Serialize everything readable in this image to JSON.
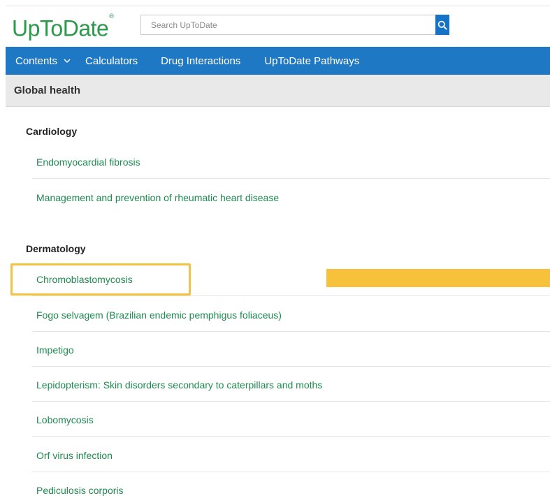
{
  "header": {
    "logo_text": "UpToDate",
    "logo_mark": "®",
    "search_placeholder": "Search UpToDate",
    "search_icon": "search-icon"
  },
  "nav": {
    "items": [
      {
        "label": "Contents",
        "has_dropdown": true
      },
      {
        "label": "Calculators"
      },
      {
        "label": "Drug Interactions"
      },
      {
        "label": "UpToDate Pathways"
      }
    ]
  },
  "page": {
    "title": "Global health"
  },
  "sections": [
    {
      "title": "Cardiology",
      "topics": [
        "Endomyocardial fibrosis",
        "Management and prevention of rheumatic heart disease"
      ]
    },
    {
      "title": "Dermatology",
      "topics": [
        "Chromoblastomycosis",
        "Fogo selvagem (Brazilian endemic pemphigus foliaceus)",
        "Impetigo",
        "Lepidopterism: Skin disorders secondary to caterpillars and moths",
        "Lobomycosis",
        "Orf virus infection",
        "Pediculosis corporis"
      ]
    }
  ],
  "colors": {
    "brand_green": "#2a9a4a",
    "nav_blue": "#1f78c4",
    "link_green": "#1e8a4f",
    "highlight_yellow": "#f6c23e"
  }
}
